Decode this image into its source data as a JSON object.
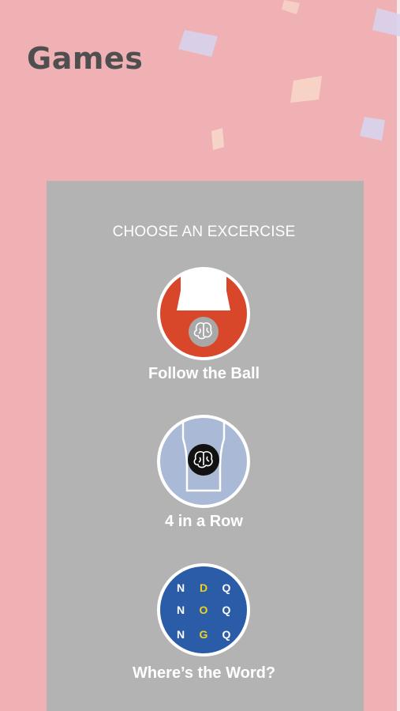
{
  "page": {
    "title": "Games"
  },
  "panel": {
    "heading": "CHOOSE AN EXCERCISE"
  },
  "games": [
    {
      "label": "Follow the Ball",
      "icon": "follow-the-ball-icon",
      "color": "#d9472a"
    },
    {
      "label": "4 in a Row",
      "icon": "four-in-a-row-icon",
      "color": "#a9b9d6"
    },
    {
      "label": "Where’s the Word?",
      "icon": "wheres-the-word-icon",
      "color": "#2b5ca8",
      "grid": [
        [
          "N",
          "D",
          "Q"
        ],
        [
          "N",
          "O",
          "Q"
        ],
        [
          "N",
          "G",
          "Q"
        ]
      ]
    }
  ],
  "colors": {
    "background": "#f0b1b5",
    "panel": "#b3b3b3",
    "title": "#4f4f4f",
    "highlight": "#f0d21f"
  }
}
